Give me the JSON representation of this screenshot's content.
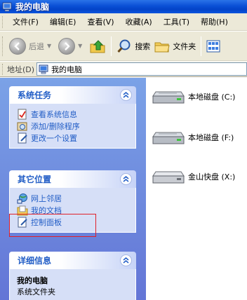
{
  "window": {
    "title": "我的电脑"
  },
  "menu": [
    "文件(F)",
    "编辑(E)",
    "查看(V)",
    "收藏(A)",
    "工具(T)",
    "帮助(H)"
  ],
  "toolbar": {
    "back_label": "后退",
    "search_label": "搜索",
    "folders_label": "文件夹"
  },
  "address": {
    "label": "地址(D)",
    "value": "我的电脑"
  },
  "panels": {
    "system_tasks": {
      "title": "系统任务",
      "items": [
        "查看系统信息",
        "添加/删除程序",
        "更改一个设置"
      ]
    },
    "other_places": {
      "title": "其它位置",
      "items": [
        "网上邻居",
        "我的文档",
        "控制面板"
      ]
    },
    "details": {
      "title": "详细信息",
      "name": "我的电脑",
      "type": "系统文件夹"
    }
  },
  "drives": [
    "本地磁盘 (C:)",
    "本地磁盘 (F:)",
    "金山快盘 (X:)"
  ]
}
